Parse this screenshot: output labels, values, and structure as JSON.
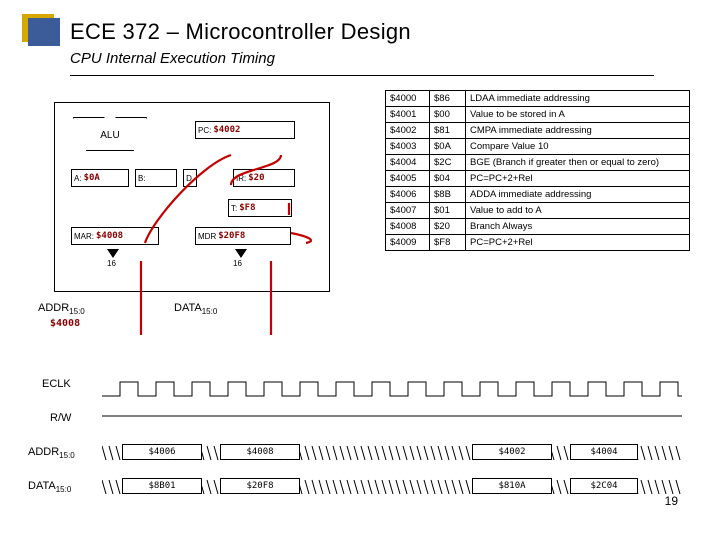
{
  "header": {
    "title": "ECE 372 – Microcontroller Design",
    "subtitle": "CPU Internal Execution Timing"
  },
  "cpu": {
    "alu_label": "ALU",
    "pc": {
      "label": "PC:",
      "value": "$4002"
    },
    "A": {
      "label": "A:",
      "value": "$0A"
    },
    "B": {
      "label": "B:",
      "value": ""
    },
    "D": {
      "label": "D",
      "value": ""
    },
    "IR": {
      "label": "IR:",
      "value": "$20"
    },
    "T": {
      "label": "T:",
      "value": "$F8"
    },
    "MAR": {
      "label": "MAR:",
      "value": "$4008"
    },
    "MDR": {
      "label": "MDR",
      "value": "$20F8"
    },
    "bits": "16"
  },
  "bus_out": {
    "addr_label": "ADDR",
    "data_label": "DATA",
    "sub": "15:0",
    "addr_value": "$4008"
  },
  "memory": [
    {
      "addr": "$4000",
      "byte": "$86",
      "desc": "LDAA immediate addressing"
    },
    {
      "addr": "$4001",
      "byte": "$00",
      "desc": "Value to be stored in A"
    },
    {
      "addr": "$4002",
      "byte": "$81",
      "desc": "CMPA immediate addressing"
    },
    {
      "addr": "$4003",
      "byte": "$0A",
      "desc": "Compare Value 10"
    },
    {
      "addr": "$4004",
      "byte": "$2C",
      "desc": "BGE (Branch if greater then or equal to zero)"
    },
    {
      "addr": "$4005",
      "byte": "$04",
      "desc": "PC=PC+2+Rel"
    },
    {
      "addr": "$4006",
      "byte": "$8B",
      "desc": "ADDA immediate addressing"
    },
    {
      "addr": "$4007",
      "byte": "$01",
      "desc": "Value to add to A"
    },
    {
      "addr": "$4008",
      "byte": "$20",
      "desc": "Branch Always"
    },
    {
      "addr": "$4009",
      "byte": "$F8",
      "desc": "PC=PC+2+Rel"
    }
  ],
  "timing": {
    "eclk": "ECLK",
    "rw": "R/W",
    "addr_label": "ADDR",
    "data_label": "DATA",
    "sub": "15:0",
    "addr_vals": [
      "$4006",
      "$4008",
      "$4002",
      "$4004"
    ],
    "data_vals": [
      "$8B01",
      "$20F8",
      "$810A",
      "$2C04"
    ]
  },
  "page_number": "19"
}
